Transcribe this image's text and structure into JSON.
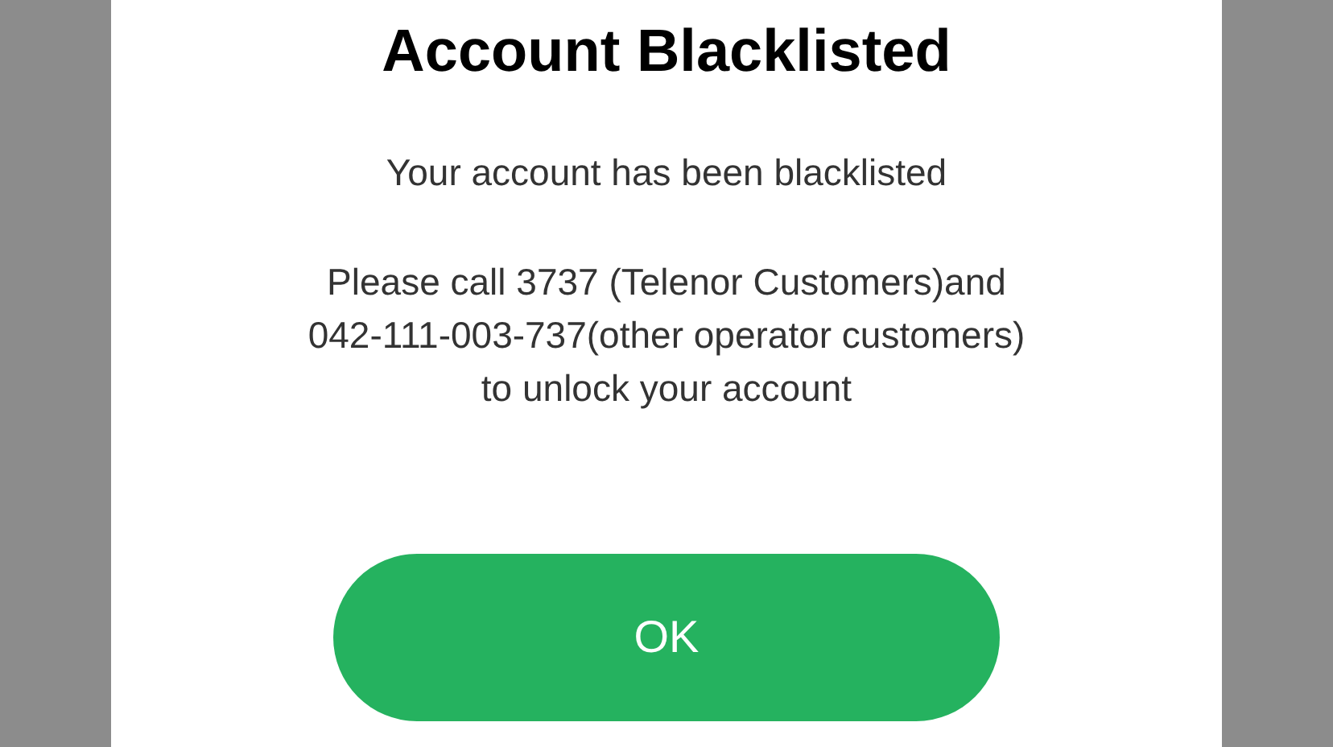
{
  "dialog": {
    "title": "Account Blacklisted",
    "subtitle": "Your account has been blacklisted",
    "message_lines": [
      "Please call 3737 (Telenor Customers)and",
      "042-111-003-737(other operator customers)",
      "to unlock your account"
    ],
    "buttons": [
      {
        "label": "OK"
      }
    ]
  }
}
